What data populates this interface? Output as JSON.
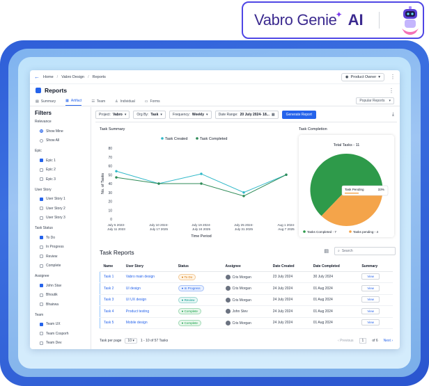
{
  "brand": {
    "name": "Vabro Genie",
    "ai": "AI"
  },
  "breadcrumb": {
    "home": "Home",
    "project": "Vabro Design",
    "page": "Reports"
  },
  "owner_select": "Product Owner",
  "page_title": "Reports",
  "tabs": [
    {
      "label": "Summary"
    },
    {
      "label": "Artifact"
    },
    {
      "label": "Team"
    },
    {
      "label": "Individual"
    },
    {
      "label": "Forms"
    }
  ],
  "popular_reports": "Popular Reports",
  "filters": {
    "title": "Filters",
    "groups": [
      {
        "label": "Relevance",
        "kind": "radio",
        "options": [
          {
            "label": "Show Mine",
            "checked": true
          },
          {
            "label": "Show All",
            "checked": false
          }
        ]
      },
      {
        "label": "Epic",
        "kind": "check",
        "options": [
          {
            "label": "Epic 1",
            "checked": true
          },
          {
            "label": "Epic 2",
            "checked": false
          },
          {
            "label": "Epic 3",
            "checked": false
          }
        ]
      },
      {
        "label": "User Story",
        "kind": "check",
        "options": [
          {
            "label": "User Story 1",
            "checked": true
          },
          {
            "label": "User Story 2",
            "checked": false
          },
          {
            "label": "User Story 3",
            "checked": false
          }
        ]
      },
      {
        "label": "Task Status",
        "kind": "check",
        "options": [
          {
            "label": "To Do",
            "checked": true
          },
          {
            "label": "In Progress",
            "checked": false
          },
          {
            "label": "Review",
            "checked": false
          },
          {
            "label": "Complete",
            "checked": false
          }
        ]
      },
      {
        "label": "Assignee",
        "kind": "check",
        "options": [
          {
            "label": "John Stav",
            "checked": true
          },
          {
            "label": "Bhoutik",
            "checked": false
          },
          {
            "label": "Bhairwa",
            "checked": false
          }
        ]
      },
      {
        "label": "Team",
        "kind": "check",
        "options": [
          {
            "label": "Team UX",
            "checked": true
          },
          {
            "label": "Team Cosporh",
            "checked": false
          },
          {
            "label": "Team Dev",
            "checked": false
          }
        ]
      }
    ]
  },
  "controls": {
    "project_label": "Project:",
    "project_value": "Vabro",
    "org_label": "Org By:",
    "org_value": "Task",
    "freq_label": "Frequency:",
    "freq_value": "Weekly",
    "date_label": "Date Range:",
    "date_value": "20 July 2024- 18...",
    "generate": "Generate Report"
  },
  "task_summary_title": "Task Summary",
  "task_completion_title": "Task Completion",
  "chart_data": [
    {
      "type": "line",
      "title": "Task Summary",
      "xlabel": "Time Period",
      "ylabel": "No. of Tasks",
      "categories": [
        "July 5 2023-July 11 2023",
        "July 10 2024-July 17 2025",
        "July 19 2024-July 24 2025",
        "July 25 2024-July 31 2025",
        "Aug 1 2024-Aug 7 2025"
      ],
      "x_ticks": [
        [
          "July 5 2023-",
          "July 11 2023"
        ],
        [
          "July 10 2024-",
          "July 17 2025"
        ],
        [
          "July 19 2024-",
          "July 24 2025"
        ],
        [
          "July 25 2024-",
          "July 31 2025"
        ],
        [
          "Aug 1 2024-",
          "Aug 7 2025"
        ]
      ],
      "ylim": [
        0,
        80
      ],
      "y_ticks": [
        "80",
        "70",
        "60",
        "50",
        "40",
        "30",
        "20",
        "10",
        "0"
      ],
      "series": [
        {
          "name": "Task Created",
          "color": "#2fb8c8",
          "values": [
            54,
            40,
            51,
            30,
            50
          ]
        },
        {
          "name": "Task Completed",
          "color": "#2e8b57",
          "values": [
            47,
            40,
            40,
            26,
            50
          ]
        }
      ],
      "legend": "top-center",
      "grid": false
    },
    {
      "type": "pie",
      "title": "Total Tasks - 11",
      "slices": [
        {
          "name": "Tasks Completed - 7",
          "value": 7,
          "color": "#2e9a4a"
        },
        {
          "name": "Tasks pending - 4",
          "value": 4,
          "color": "#f4a44a"
        }
      ],
      "tooltip": {
        "label": "Task Pending",
        "value": "33%"
      },
      "legend": "bottom"
    }
  ],
  "reports": {
    "title": "Task Reports",
    "search_placeholder": "Search",
    "columns": [
      "Name",
      "User Story",
      "Status",
      "Assignee",
      "Date Created",
      "Date Completed",
      "Summary"
    ],
    "rows": [
      {
        "name": "Task 1",
        "story": "Vabro main design",
        "status": "To Do",
        "status_bg": "#fff4e5",
        "status_fg": "#d97706",
        "assignee": "Cris Morgan",
        "created": "23 July 2024",
        "completed": "30 July 2024",
        "view": "View"
      },
      {
        "name": "Task 2",
        "story": "UI design",
        "status": "In Progress",
        "status_bg": "#e8f0ff",
        "status_fg": "#2563eb",
        "assignee": "Cris Morgan",
        "created": "24 July 2024",
        "completed": "01 Aug 2024",
        "view": "View"
      },
      {
        "name": "Task 3",
        "story": "UI UX design",
        "status": "Review",
        "status_bg": "#e6f7f5",
        "status_fg": "#0f9b8e",
        "assignee": "Cris Morgan",
        "created": "24 July 2024",
        "completed": "01 Aug 2024",
        "view": "View"
      },
      {
        "name": "Task 4",
        "story": "Product testing",
        "status": "Complete",
        "status_bg": "#e8f7ec",
        "status_fg": "#16a34a",
        "assignee": "John Stev",
        "created": "24 July 2024",
        "completed": "01 Aug 2024",
        "view": "View"
      },
      {
        "name": "Task 5",
        "story": "Mobile design",
        "status": "Complete",
        "status_bg": "#e8f7ec",
        "status_fg": "#16a34a",
        "assignee": "Cris Morgan",
        "created": "24 July 2024",
        "completed": "01 Aug 2024",
        "view": "View"
      }
    ]
  },
  "pager": {
    "per_page_label": "Task per page",
    "per_page": "10",
    "range": "1 - 10 of 57 Tasks",
    "previous": "Previous",
    "page": "1",
    "of": "of 6",
    "next": "Next"
  }
}
